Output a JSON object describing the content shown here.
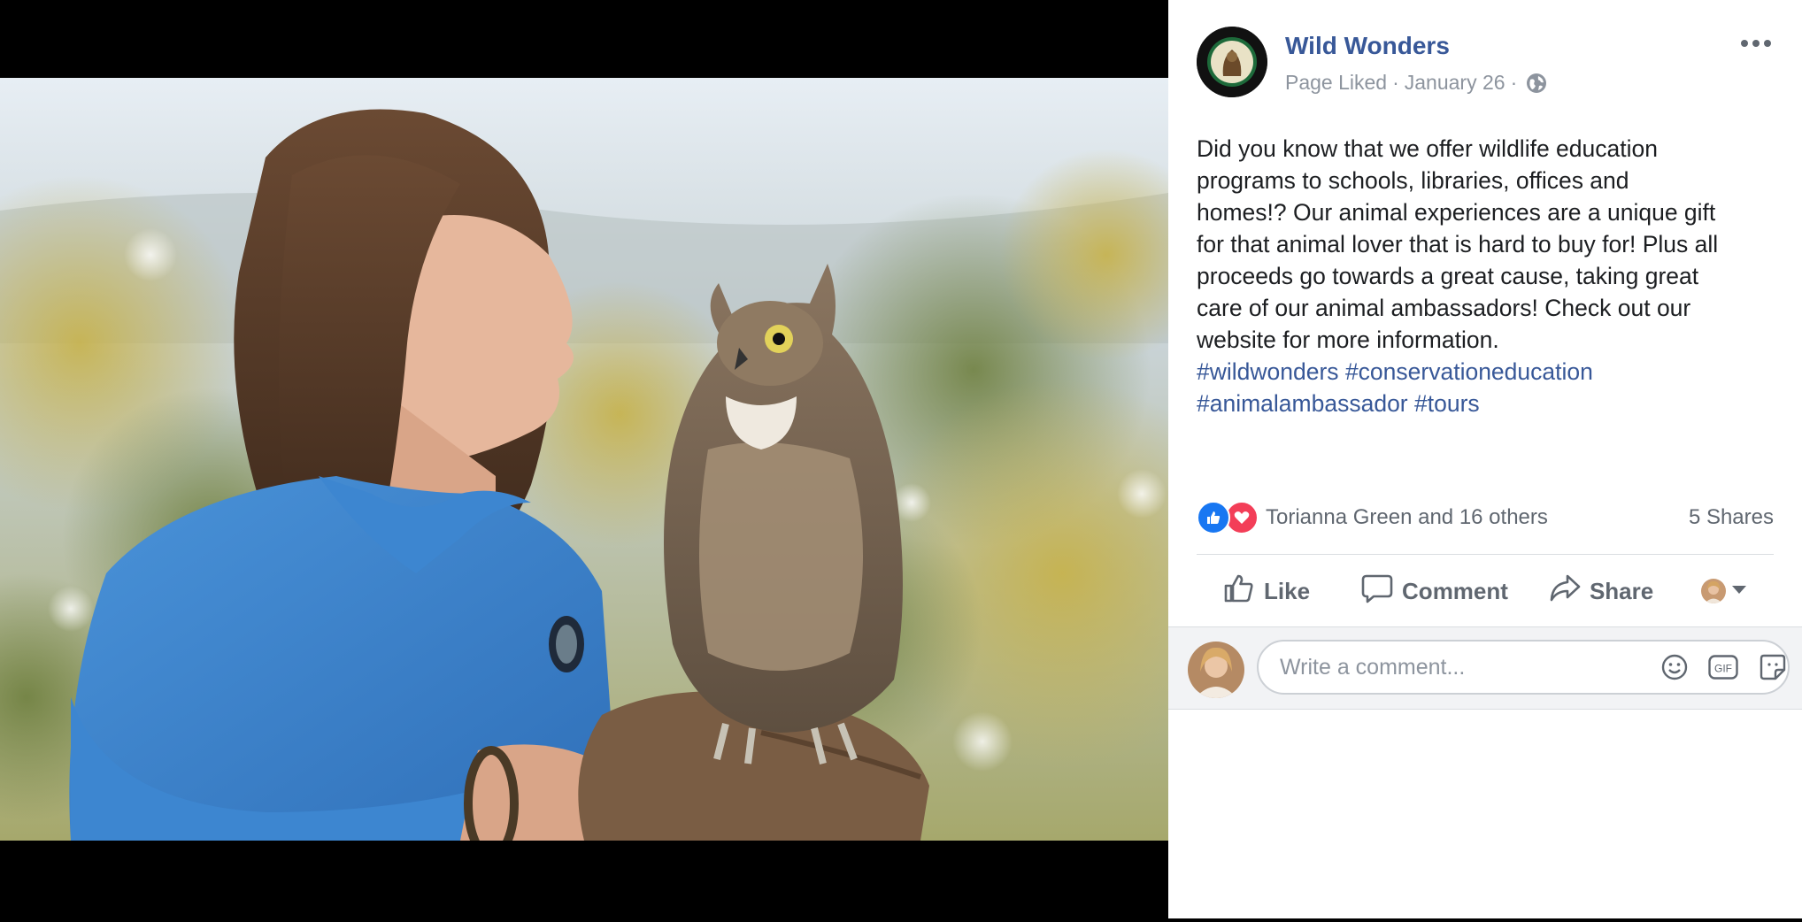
{
  "post": {
    "page_name": "Wild Wonders",
    "status": "Page Liked",
    "separator": "·",
    "date": "January 26",
    "body_lines": [
      "Did you know that we offer wildlife education",
      "programs to schools, libraries, offices and",
      "homes!? Our animal experiences are a unique gift",
      "for that animal lover that is hard to buy for! Plus all",
      "proceeds go towards a great cause, taking great",
      "care of our animal ambassadors! Check out our",
      "website for more information."
    ],
    "hashtags": [
      "#wildwonders",
      "#conservationeducation",
      "#animalambassador",
      "#tours"
    ]
  },
  "reactions": {
    "icons": [
      "like-icon",
      "love-icon"
    ],
    "summary": "Torianna Green and 16 others",
    "shares": "5 Shares"
  },
  "actions": {
    "like": "Like",
    "comment": "Comment",
    "share": "Share"
  },
  "comment": {
    "placeholder": "Write a comment...",
    "tools": [
      "emoji-icon",
      "gif-icon",
      "sticker-icon"
    ]
  },
  "colors": {
    "link": "#385898",
    "like_blue": "#1877f2",
    "love_red": "#f33e58",
    "muted": "#606770"
  }
}
